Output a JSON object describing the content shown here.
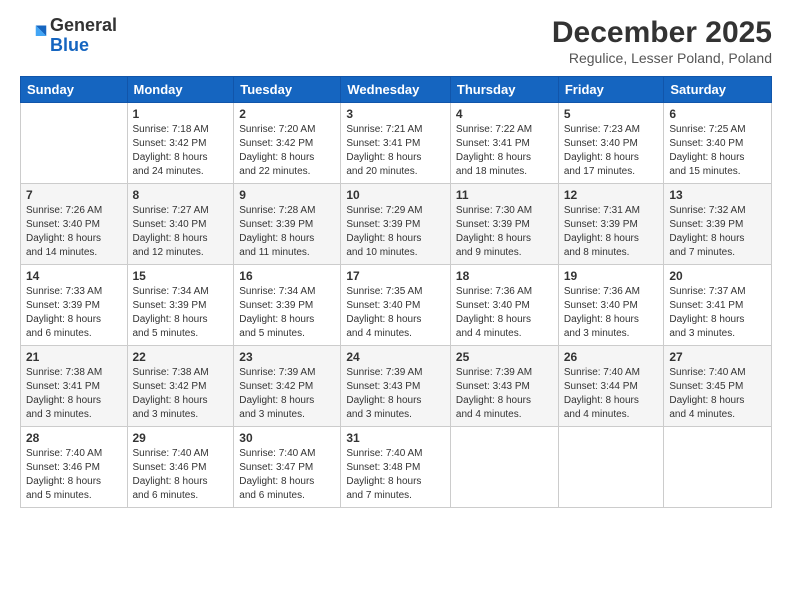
{
  "header": {
    "logo_line1": "General",
    "logo_line2": "Blue",
    "month_title": "December 2025",
    "subtitle": "Regulice, Lesser Poland, Poland"
  },
  "weekdays": [
    "Sunday",
    "Monday",
    "Tuesday",
    "Wednesday",
    "Thursday",
    "Friday",
    "Saturday"
  ],
  "weeks": [
    [
      {
        "day": "",
        "info": ""
      },
      {
        "day": "1",
        "info": "Sunrise: 7:18 AM\nSunset: 3:42 PM\nDaylight: 8 hours\nand 24 minutes."
      },
      {
        "day": "2",
        "info": "Sunrise: 7:20 AM\nSunset: 3:42 PM\nDaylight: 8 hours\nand 22 minutes."
      },
      {
        "day": "3",
        "info": "Sunrise: 7:21 AM\nSunset: 3:41 PM\nDaylight: 8 hours\nand 20 minutes."
      },
      {
        "day": "4",
        "info": "Sunrise: 7:22 AM\nSunset: 3:41 PM\nDaylight: 8 hours\nand 18 minutes."
      },
      {
        "day": "5",
        "info": "Sunrise: 7:23 AM\nSunset: 3:40 PM\nDaylight: 8 hours\nand 17 minutes."
      },
      {
        "day": "6",
        "info": "Sunrise: 7:25 AM\nSunset: 3:40 PM\nDaylight: 8 hours\nand 15 minutes."
      }
    ],
    [
      {
        "day": "7",
        "info": "Sunrise: 7:26 AM\nSunset: 3:40 PM\nDaylight: 8 hours\nand 14 minutes."
      },
      {
        "day": "8",
        "info": "Sunrise: 7:27 AM\nSunset: 3:40 PM\nDaylight: 8 hours\nand 12 minutes."
      },
      {
        "day": "9",
        "info": "Sunrise: 7:28 AM\nSunset: 3:39 PM\nDaylight: 8 hours\nand 11 minutes."
      },
      {
        "day": "10",
        "info": "Sunrise: 7:29 AM\nSunset: 3:39 PM\nDaylight: 8 hours\nand 10 minutes."
      },
      {
        "day": "11",
        "info": "Sunrise: 7:30 AM\nSunset: 3:39 PM\nDaylight: 8 hours\nand 9 minutes."
      },
      {
        "day": "12",
        "info": "Sunrise: 7:31 AM\nSunset: 3:39 PM\nDaylight: 8 hours\nand 8 minutes."
      },
      {
        "day": "13",
        "info": "Sunrise: 7:32 AM\nSunset: 3:39 PM\nDaylight: 8 hours\nand 7 minutes."
      }
    ],
    [
      {
        "day": "14",
        "info": "Sunrise: 7:33 AM\nSunset: 3:39 PM\nDaylight: 8 hours\nand 6 minutes."
      },
      {
        "day": "15",
        "info": "Sunrise: 7:34 AM\nSunset: 3:39 PM\nDaylight: 8 hours\nand 5 minutes."
      },
      {
        "day": "16",
        "info": "Sunrise: 7:34 AM\nSunset: 3:39 PM\nDaylight: 8 hours\nand 5 minutes."
      },
      {
        "day": "17",
        "info": "Sunrise: 7:35 AM\nSunset: 3:40 PM\nDaylight: 8 hours\nand 4 minutes."
      },
      {
        "day": "18",
        "info": "Sunrise: 7:36 AM\nSunset: 3:40 PM\nDaylight: 8 hours\nand 4 minutes."
      },
      {
        "day": "19",
        "info": "Sunrise: 7:36 AM\nSunset: 3:40 PM\nDaylight: 8 hours\nand 3 minutes."
      },
      {
        "day": "20",
        "info": "Sunrise: 7:37 AM\nSunset: 3:41 PM\nDaylight: 8 hours\nand 3 minutes."
      }
    ],
    [
      {
        "day": "21",
        "info": "Sunrise: 7:38 AM\nSunset: 3:41 PM\nDaylight: 8 hours\nand 3 minutes."
      },
      {
        "day": "22",
        "info": "Sunrise: 7:38 AM\nSunset: 3:42 PM\nDaylight: 8 hours\nand 3 minutes."
      },
      {
        "day": "23",
        "info": "Sunrise: 7:39 AM\nSunset: 3:42 PM\nDaylight: 8 hours\nand 3 minutes."
      },
      {
        "day": "24",
        "info": "Sunrise: 7:39 AM\nSunset: 3:43 PM\nDaylight: 8 hours\nand 3 minutes."
      },
      {
        "day": "25",
        "info": "Sunrise: 7:39 AM\nSunset: 3:43 PM\nDaylight: 8 hours\nand 4 minutes."
      },
      {
        "day": "26",
        "info": "Sunrise: 7:40 AM\nSunset: 3:44 PM\nDaylight: 8 hours\nand 4 minutes."
      },
      {
        "day": "27",
        "info": "Sunrise: 7:40 AM\nSunset: 3:45 PM\nDaylight: 8 hours\nand 4 minutes."
      }
    ],
    [
      {
        "day": "28",
        "info": "Sunrise: 7:40 AM\nSunset: 3:46 PM\nDaylight: 8 hours\nand 5 minutes."
      },
      {
        "day": "29",
        "info": "Sunrise: 7:40 AM\nSunset: 3:46 PM\nDaylight: 8 hours\nand 6 minutes."
      },
      {
        "day": "30",
        "info": "Sunrise: 7:40 AM\nSunset: 3:47 PM\nDaylight: 8 hours\nand 6 minutes."
      },
      {
        "day": "31",
        "info": "Sunrise: 7:40 AM\nSunset: 3:48 PM\nDaylight: 8 hours\nand 7 minutes."
      },
      {
        "day": "",
        "info": ""
      },
      {
        "day": "",
        "info": ""
      },
      {
        "day": "",
        "info": ""
      }
    ]
  ]
}
